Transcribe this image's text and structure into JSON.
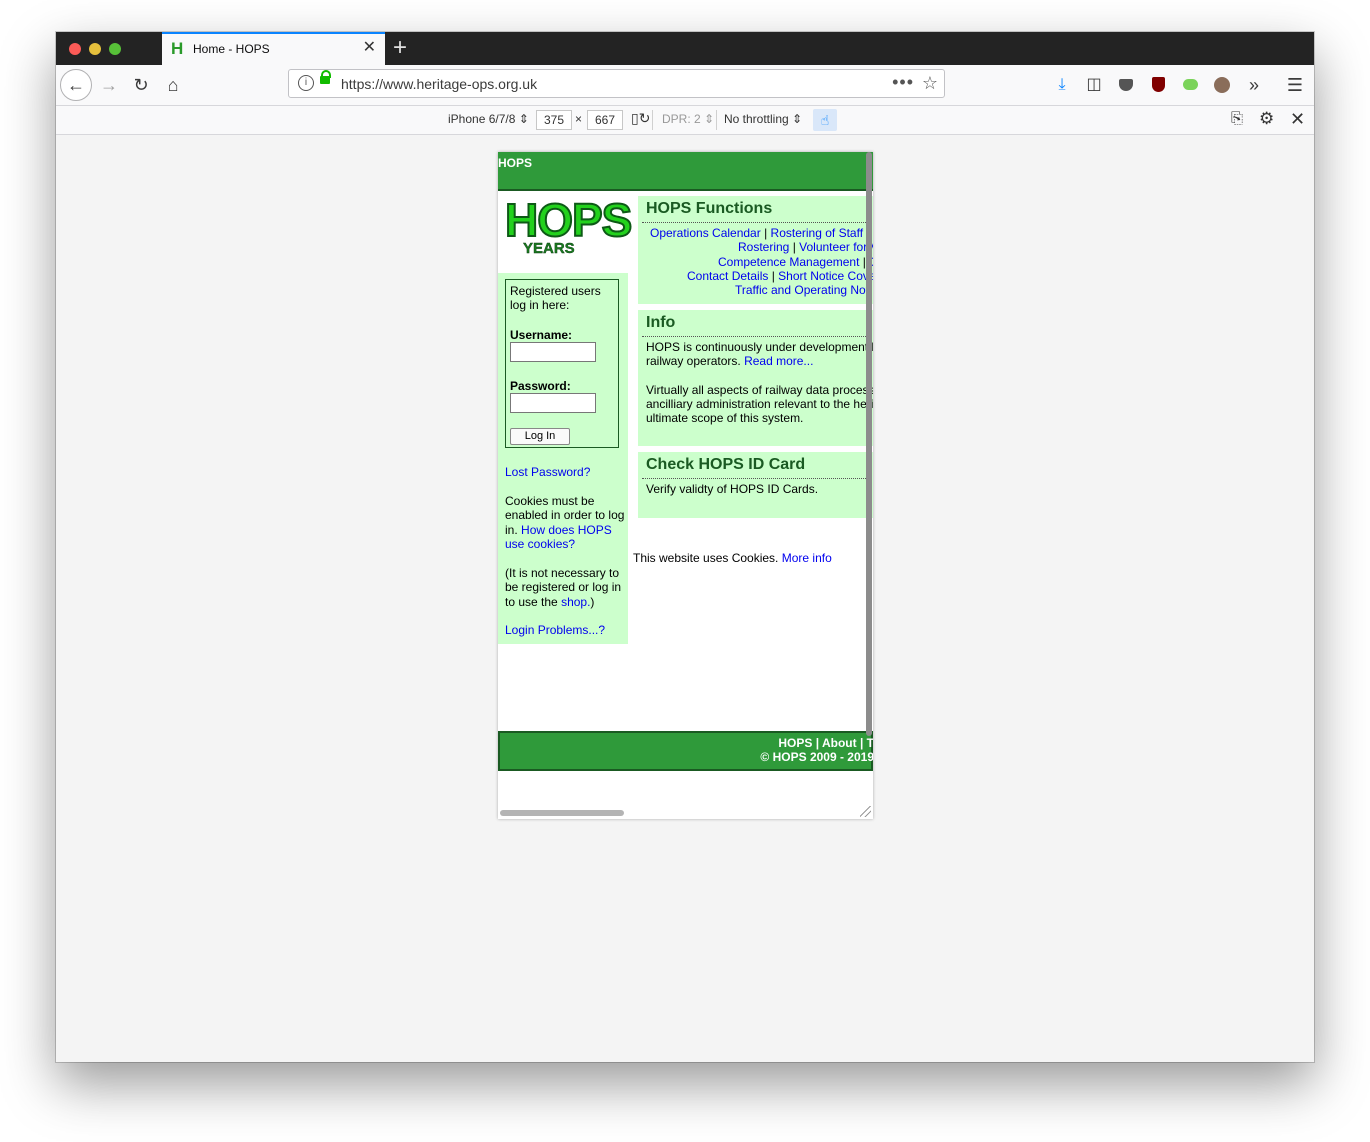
{
  "browser": {
    "tab": {
      "title": "Home - HOPS",
      "favicon": "H"
    },
    "url": "https://www.heritage-ops.org.uk",
    "toolbar_icons": [
      "back-arrow-icon",
      "forward-arrow-icon",
      "reload-icon",
      "home-icon",
      "info-icon",
      "lock-icon",
      "page-actions-icon",
      "bookmark-star-icon",
      "download-icon",
      "sidebar-icon",
      "pocket-icon",
      "ublock-icon",
      "extension-icon",
      "avatar",
      "overflow-chevron-icon",
      "hamburger-menu-icon"
    ]
  },
  "rdm": {
    "device": "iPhone 6/7/8 ⇕",
    "width": "375",
    "times": "×",
    "height": "667",
    "dpr": "DPR: 2 ⇕",
    "throttling": "No throttling ⇕"
  },
  "site": {
    "header_title": "HOPS",
    "logo": {
      "main": "HOPS",
      "sub": "YEARS"
    },
    "login": {
      "intro": "Registered users log in here:",
      "username_label": "Username:",
      "password_label": "Password:",
      "login_button": "Log In"
    },
    "lost_password": "Lost Password?",
    "cookies_text": "Cookies must be enabled in order to log in.",
    "cookies_link": "How does HOPS use cookies?",
    "not_necessary_text": "(It is not necessary to be registered or log in to use the",
    "shop_link": "shop.",
    "not_necessary_end": ")",
    "login_problems": "Login Problems...?",
    "functions": {
      "title": "HOPS Functions",
      "line1": {
        "a": "Operations Calendar",
        "sep1": " | ",
        "b": "Rostering of Staff",
        "sep2": " | ."
      },
      "line2": {
        "a": "Rostering",
        "sep1": " | ",
        "b": "Volunteer for V"
      },
      "line3": {
        "a": "Competence Management",
        "sep1": " | ",
        "b": "C"
      },
      "line4": {
        "a": "Contact Details",
        "sep1": " | ",
        "b": "Short Notice Cove"
      },
      "line5": {
        "a": "Traffic and Operating Noti"
      }
    },
    "info": {
      "title": "Info",
      "line1": "HOPS is continuously under development l",
      "line2": "railway operators.",
      "read_more": "Read more...",
      "line3": "Virtually all aspects of railway data process",
      "line4": "ancilliary administration relevant to the heri",
      "line5": "ultimate scope of this system."
    },
    "idcard": {
      "title": "Check HOPS ID Card",
      "link": "Verify validty of HOPS ID Cards."
    },
    "cookie_notice": {
      "text": "This website uses Cookies.",
      "link": "More info"
    },
    "footer": {
      "link_hops": "HOPS",
      "sep1": " | ",
      "link_about": "About",
      "sep2": " | T",
      "copyright": "© HOPS 2009 - 2019"
    }
  }
}
